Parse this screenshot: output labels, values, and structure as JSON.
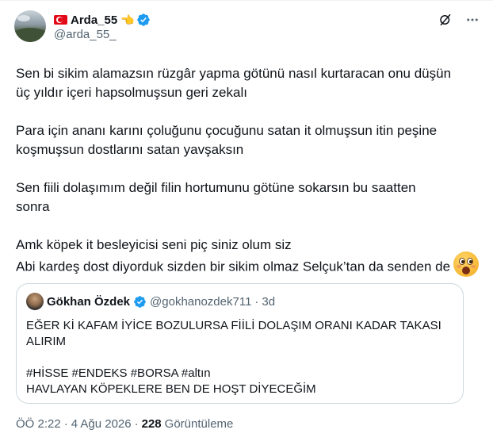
{
  "author": {
    "display_name": "Arda_55",
    "handle": "@arda_55_",
    "flag_icon": "turkey-flag-icon",
    "emoji_icon": "backhand-index-pointing-left-icon",
    "verified_color": "#1d9bf0"
  },
  "top_actions": {
    "grok_icon": "grok-icon",
    "more_icon": "more-horizontal-icon"
  },
  "body": {
    "lines": [
      "Sen bi sikim alamazsın rüzgâr yapma götünü nasıl kurtaracan onu düşün",
      "üç yıldır içeri hapsolmuşsun geri zekalı",
      "Para için ananı karını çoluğunu çocuğunu satan it olmuşsun itin peşine",
      "koşmuşsun dostlarını satan yavşaksın",
      "Sen fiili dolaşımım değil filin hortumunu götüne sokarsın bu saatten",
      "sonra",
      "Amk köpek it  besleyicisi seni piç siniz olum siz",
      "Abi kardeş dost diyorduk sizden bir sikim olmaz Selçuk’tan da senden de"
    ],
    "end_emoji": "face-screaming-surprised-icon"
  },
  "quote": {
    "display_name": "Gökhan Özdek",
    "handle": "@gokhanozdek711",
    "separator": "·",
    "time": "3d",
    "lines": [
      "EĞER Kİ KAFAM İYİCE BOZULURSA FİİLİ DOLAŞIM  ORANI KADAR TAKASI",
      "ALIRIM",
      "#HİSSE #ENDEKS #BORSA #altın",
      "HAVLAYAN KÖPEKLERE BEN DE HOŞT DİYECEĞİM"
    ]
  },
  "meta": {
    "time": "ÖÖ 2:22",
    "separator": "·",
    "date": "4 Ağu 2026",
    "separator2": "·",
    "views_count": "228",
    "views_label": "Görüntüleme"
  },
  "colors": {
    "text": "#0f1419",
    "muted": "#536471",
    "border": "#cfd9de",
    "accent": "#1d9bf0"
  }
}
